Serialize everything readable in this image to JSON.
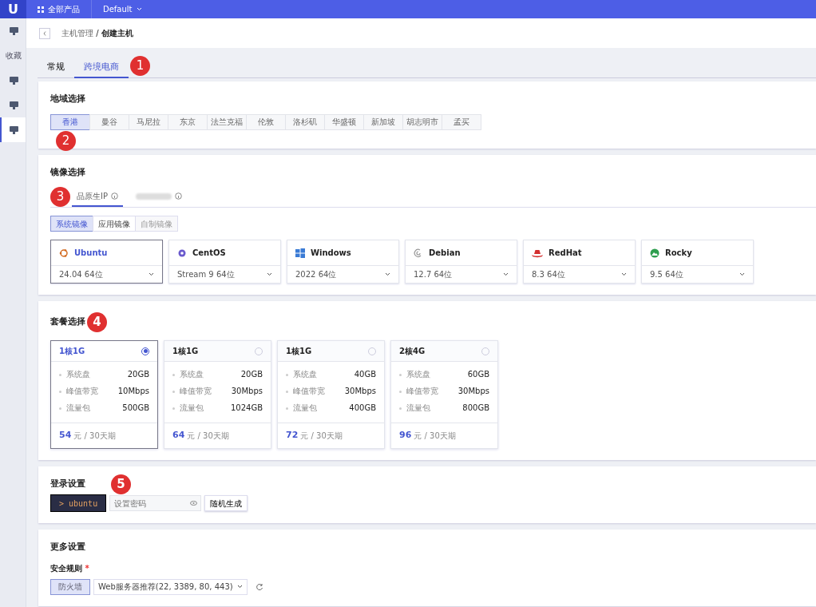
{
  "topbar": {
    "logo": "U",
    "products": "全部产品",
    "project": "Default"
  },
  "sidebar": {
    "items": [
      {
        "kind": "icon",
        "selected": false
      },
      {
        "kind": "label",
        "label": "收藏",
        "selected": false
      },
      {
        "kind": "icon",
        "selected": false
      },
      {
        "kind": "icon",
        "selected": false
      },
      {
        "kind": "icon",
        "selected": true
      }
    ]
  },
  "breadcrumb": {
    "parent": "主机管理",
    "separator": "/",
    "current": "创建主机"
  },
  "tabs": [
    {
      "label": "常规",
      "selected": false
    },
    {
      "label": "跨境电商",
      "selected": true,
      "marker": "1"
    }
  ],
  "region": {
    "title": "地域选择",
    "marker": "2",
    "items": [
      {
        "label": "香港",
        "selected": true
      },
      {
        "label": "曼谷",
        "selected": false
      },
      {
        "label": "马尼拉",
        "selected": false
      },
      {
        "label": "东京",
        "selected": false
      },
      {
        "label": "法兰克福",
        "selected": false
      },
      {
        "label": "伦敦",
        "selected": false
      },
      {
        "label": "洛杉矶",
        "selected": false
      },
      {
        "label": "华盛顿",
        "selected": false
      },
      {
        "label": "新加坡",
        "selected": false
      },
      {
        "label": "胡志明市",
        "selected": false
      },
      {
        "label": "孟买",
        "selected": false
      }
    ]
  },
  "image": {
    "title": "镜像选择",
    "marker": "3",
    "tabs": [
      {
        "label": "品原生IP",
        "selected": true
      },
      {
        "selected": false
      }
    ],
    "subtabs": [
      {
        "label": "系统镜像",
        "selected": true,
        "disabled": false
      },
      {
        "label": "应用镜像",
        "selected": false,
        "disabled": false
      },
      {
        "label": "自制镜像",
        "selected": false,
        "disabled": true
      }
    ],
    "os": [
      {
        "name": "Ubuntu",
        "version": "24.04 64位",
        "selected": true
      },
      {
        "name": "CentOS",
        "version": "Stream 9 64位",
        "selected": false
      },
      {
        "name": "Windows",
        "version": "2022 64位",
        "selected": false
      },
      {
        "name": "Debian",
        "version": "12.7 64位",
        "selected": false
      },
      {
        "name": "RedHat",
        "version": "8.3 64位",
        "selected": false
      },
      {
        "name": "Rocky",
        "version": "9.5 64位",
        "selected": false
      }
    ]
  },
  "plans": {
    "title": "套餐选择",
    "marker": "4",
    "items": [
      {
        "name": "1核1G",
        "selected": true,
        "specs": [
          [
            "系统盘",
            "20GB"
          ],
          [
            "峰值带宽",
            "10Mbps"
          ],
          [
            "流量包",
            "500GB"
          ]
        ],
        "price": "54",
        "unit": "元 / 30天期"
      },
      {
        "name": "1核1G",
        "selected": false,
        "specs": [
          [
            "系统盘",
            "20GB"
          ],
          [
            "峰值带宽",
            "30Mbps"
          ],
          [
            "流量包",
            "1024GB"
          ]
        ],
        "price": "64",
        "unit": "元 / 30天期"
      },
      {
        "name": "1核1G",
        "selected": false,
        "specs": [
          [
            "系统盘",
            "40GB"
          ],
          [
            "峰值带宽",
            "30Mbps"
          ],
          [
            "流量包",
            "400GB"
          ]
        ],
        "price": "72",
        "unit": "元 / 30天期"
      },
      {
        "name": "2核4G",
        "selected": false,
        "specs": [
          [
            "系统盘",
            "60GB"
          ],
          [
            "峰值带宽",
            "30Mbps"
          ],
          [
            "流量包",
            "800GB"
          ]
        ],
        "price": "96",
        "unit": "元 / 30天期"
      }
    ]
  },
  "login": {
    "title": "登录设置",
    "marker": "5",
    "user": "> ubuntu",
    "placeholder": "设置密码",
    "button": "随机生成"
  },
  "more": {
    "title": "更多设置",
    "rule_label": "安全规则",
    "required_mark": "*",
    "button": "防火墙",
    "select": "Web服务器推荐(22, 3389, 80, 443)"
  }
}
